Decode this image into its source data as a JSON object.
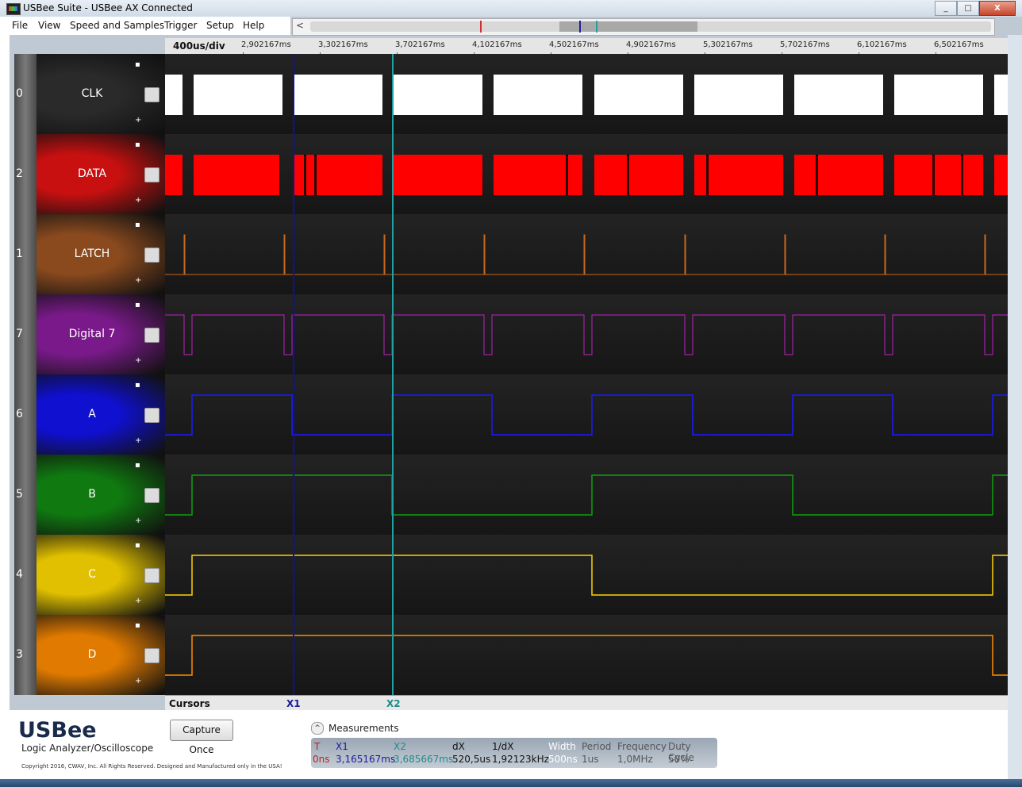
{
  "window": {
    "title": "USBee Suite - USBee AX Connected",
    "controls": [
      "_",
      "□",
      "X"
    ]
  },
  "menu": [
    {
      "label": "File"
    },
    {
      "label": "View"
    },
    {
      "label": "Speed and Samples"
    },
    {
      "label": "Trigger"
    },
    {
      "label": "Setup"
    },
    {
      "label": "Help"
    }
  ],
  "overview": {
    "arrow": "<"
  },
  "timebase": {
    "label": "400us/div",
    "ticks": [
      "2,902167ms",
      "3,302167ms",
      "3,702167ms",
      "4,102167ms",
      "4,502167ms",
      "4,902167ms",
      "5,302167ms",
      "5,702167ms",
      "6,102167ms",
      "6,502167ms"
    ]
  },
  "channels": [
    {
      "num": "0",
      "name": "CLK",
      "color": "#ffffff",
      "bg": "#2a2a2a",
      "x": "▪",
      "plus": "+"
    },
    {
      "num": "2",
      "name": "DATA",
      "color": "#ff0000",
      "bg": "#c81010",
      "x": "▪",
      "plus": "+"
    },
    {
      "num": "1",
      "name": "LATCH",
      "color": "#c86a20",
      "bg": "#8a4a1e",
      "x": "▪",
      "plus": "+"
    },
    {
      "num": "7",
      "name": "Digital 7",
      "color": "#c020c0",
      "bg": "#7a1a8a",
      "x": "▪",
      "plus": "+"
    },
    {
      "num": "6",
      "name": "A",
      "color": "#1a1aff",
      "bg": "#1010d0",
      "x": "▪",
      "plus": "+"
    },
    {
      "num": "5",
      "name": "B",
      "color": "#10a010",
      "bg": "#107a10",
      "x": "▪",
      "plus": "+"
    },
    {
      "num": "4",
      "name": "C",
      "color": "#ffd200",
      "bg": "#e0c000",
      "x": "▪",
      "plus": "+"
    },
    {
      "num": "3",
      "name": "D",
      "color": "#ff8c00",
      "bg": "#e07a00",
      "x": "▪",
      "plus": "+"
    }
  ],
  "cursors": {
    "label": "Cursors",
    "x1": "X1",
    "x2": "X2",
    "x1_color": "#1010a0",
    "x2_color": "#20a0a0"
  },
  "branding": {
    "logo": "USBee",
    "subtitle": "Logic Analyzer/Oscilloscope",
    "copyright": "Copyright 2016, CWAV, Inc. All Rights Reserved. Designed and Manufactured only in the USA!"
  },
  "capture_button": "Capture Once",
  "measurements": {
    "title": "Measurements",
    "toggle": "^",
    "columns": [
      {
        "header": "T",
        "value": "0ns",
        "hcolor": "#c02020",
        "vcolor": "#c02020"
      },
      {
        "header": "X1",
        "value": "3,165167ms",
        "hcolor": "#1a1a9a",
        "vcolor": "#1a1a9a"
      },
      {
        "header": "X2",
        "value": "3,685667ms",
        "hcolor": "#208a8a",
        "vcolor": "#208a8a"
      },
      {
        "header": "dX",
        "value": "520,5us",
        "hcolor": "#111111",
        "vcolor": "#111111"
      },
      {
        "header": "1/dX",
        "value": "1,92123kHz",
        "hcolor": "#111111",
        "vcolor": "#111111"
      },
      {
        "header": "Width",
        "value": "500ns",
        "hcolor": "#ffffff",
        "vcolor": "#ffffff"
      },
      {
        "header": "Period",
        "value": "1us",
        "hcolor": "#555555",
        "vcolor": "#555555"
      },
      {
        "header": "Frequency",
        "value": "1,0MHz",
        "hcolor": "#555555",
        "vcolor": "#555555"
      },
      {
        "header": "Duty Cycle",
        "value": "50%",
        "hcolor": "#555555",
        "vcolor": "#555555"
      }
    ]
  }
}
